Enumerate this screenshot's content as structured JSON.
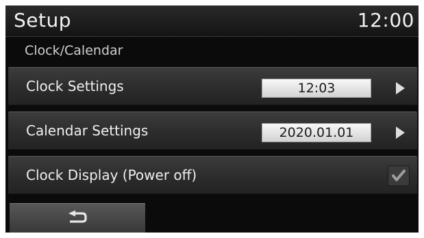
{
  "header": {
    "title": "Setup",
    "clock": "12:00"
  },
  "section": {
    "title": "Clock/Calendar"
  },
  "rows": [
    {
      "label": "Clock Settings",
      "value": "12:03",
      "icon": "chevron-right-icon"
    },
    {
      "label": "Calendar Settings",
      "value": "2020.01.01",
      "icon": "chevron-right-icon"
    },
    {
      "label": "Clock Display (Power off)",
      "checked": true,
      "icon": "checkmark-icon"
    }
  ],
  "footer": {
    "back_icon": "back-arrow-icon"
  }
}
